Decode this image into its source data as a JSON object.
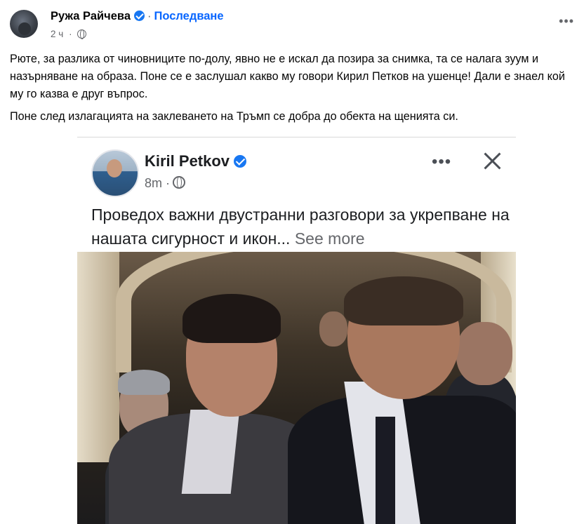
{
  "post": {
    "author": "Ружа Райчева",
    "separator": "·",
    "follow_label": "Последване",
    "time": "2 ч",
    "more_label": "•••",
    "paragraphs": [
      "Рюте, за разлика от чиновниците по-долу, явно не е искал да позира за снимка, та се налага зуум и назърняване на образа. Поне се е заслушал какво му говори Кирил Петков на ушенце! Дали е знаел кой му го казва е друг въпрос.",
      "Поне след излагацията на заклеването на Тръмп се добра до обекта на щенията си."
    ]
  },
  "embedded": {
    "author": "Kiril Petkov",
    "time": "8m",
    "more_label": "•••",
    "text": "Проведох важни двустранни разговори за укрепване на нашата сигурност и икон...",
    "see_more": "See more"
  },
  "icons": {
    "verified": "verified-badge-icon",
    "globe": "globe-icon",
    "more": "more-options-icon",
    "close": "close-icon"
  },
  "colors": {
    "accent": "#0866ff",
    "verified": "#1877f2",
    "secondary_text": "#65676b"
  }
}
